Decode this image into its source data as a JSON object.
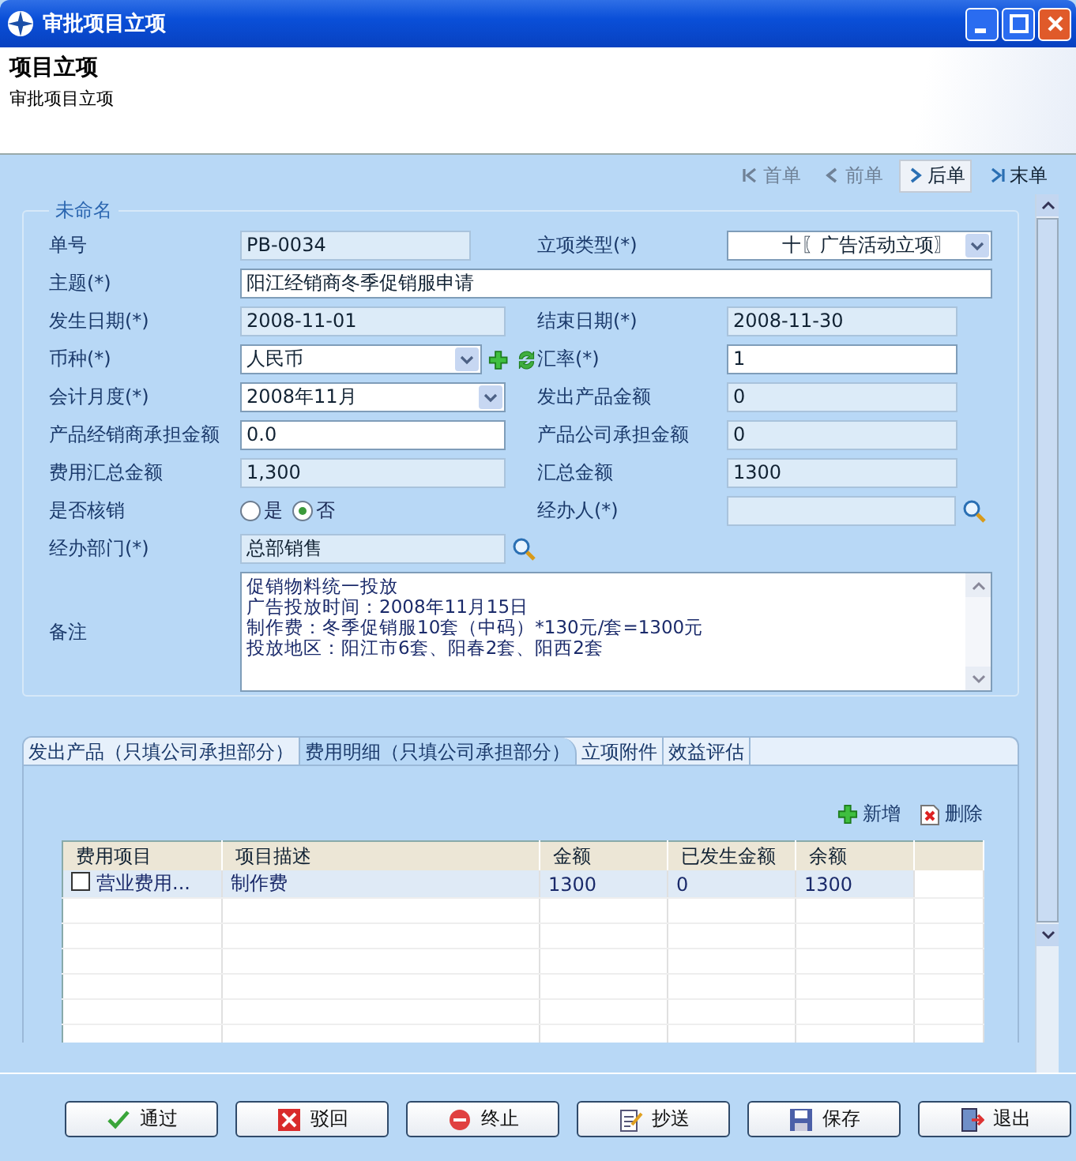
{
  "window": {
    "title": "审批项目立项"
  },
  "header": {
    "title": "项目立项",
    "subtitle": "审批项目立项"
  },
  "nav": [
    {
      "label": "首单",
      "kind": "first",
      "disabled": true,
      "hovered": false
    },
    {
      "label": "前单",
      "kind": "prev",
      "disabled": true,
      "hovered": false
    },
    {
      "label": "后单",
      "kind": "next",
      "disabled": false,
      "hovered": true
    },
    {
      "label": "末单",
      "kind": "last",
      "disabled": false,
      "hovered": false
    }
  ],
  "form": {
    "legend": "未命名",
    "rows": [
      [
        {
          "label": "单号",
          "kind": "readonly",
          "value": "PB-0034"
        },
        {
          "label": "立项类型(*)",
          "kind": "select-right",
          "value": "十〖广告活动立项〗"
        }
      ],
      [
        {
          "label": "主题(*)",
          "kind": "input",
          "value": "阳江经销商冬季促销服申请"
        }
      ],
      [
        {
          "label": "发生日期(*)",
          "kind": "readonly",
          "value": "2008-11-01"
        },
        {
          "label": "结束日期(*)",
          "kind": "readonly",
          "value": "2008-11-30"
        }
      ],
      [
        {
          "label": "币种(*)",
          "kind": "currency",
          "value": "人民币"
        },
        {
          "label": "汇率(*)",
          "kind": "input",
          "value": "1"
        }
      ],
      [
        {
          "label": "会计月度(*)",
          "kind": "select",
          "value": "2008年11月"
        },
        {
          "label": "发出产品金额",
          "kind": "readonly",
          "value": "0"
        }
      ],
      [
        {
          "label": "产品经销商承担金额",
          "kind": "input",
          "value": "0.0"
        },
        {
          "label": "产品公司承担金额",
          "kind": "readonly",
          "value": "0"
        }
      ],
      [
        {
          "label": "费用汇总金额",
          "kind": "readonly",
          "value": "1,300"
        },
        {
          "label": "汇总金额",
          "kind": "readonly",
          "value": "1300"
        }
      ],
      [
        {
          "label": "是否核销",
          "kind": "radio",
          "options": [
            {
              "label": "是",
              "selected": false
            },
            {
              "label": "否",
              "selected": true
            }
          ]
        },
        {
          "label": "经办人(*)",
          "kind": "lookup-wide"
        }
      ],
      [
        {
          "label": "经办部门(*)",
          "kind": "lookup",
          "value": "总部销售"
        }
      ]
    ],
    "remark": {
      "label": "备注",
      "lines": [
        "促销物料统一投放",
        "广告投放时间：2008年11月15日",
        "制作费：冬季促销服10套（中码）*130元/套=1300元",
        "投放地区：阳江市6套、阳春2套、阳西2套"
      ]
    }
  },
  "tabs": [
    {
      "label": "发出产品（只填公司承担部分）",
      "selected": false
    },
    {
      "label": "费用明细（只填公司承担部分）",
      "selected": true
    },
    {
      "label": "立项附件",
      "selected": false
    },
    {
      "label": "效益评估",
      "selected": false
    }
  ],
  "grid_actions": [
    {
      "label": "新增",
      "kind": "add"
    },
    {
      "label": "删除",
      "kind": "delete"
    }
  ],
  "table": {
    "columns": [
      "费用项目",
      "项目描述",
      "金额",
      "已发生金额",
      "余额"
    ],
    "rows": [
      {
        "checked": false,
        "cells": [
          "营业费用...",
          "制作费",
          "1300",
          "0",
          "1300"
        ]
      }
    ]
  },
  "buttons": [
    {
      "label": "通过",
      "kind": "approve"
    },
    {
      "label": "驳回",
      "kind": "reject"
    },
    {
      "label": "终止",
      "kind": "stop"
    },
    {
      "label": "抄送",
      "kind": "copy"
    },
    {
      "label": "保存",
      "kind": "save"
    },
    {
      "label": "退出",
      "kind": "exit"
    }
  ]
}
